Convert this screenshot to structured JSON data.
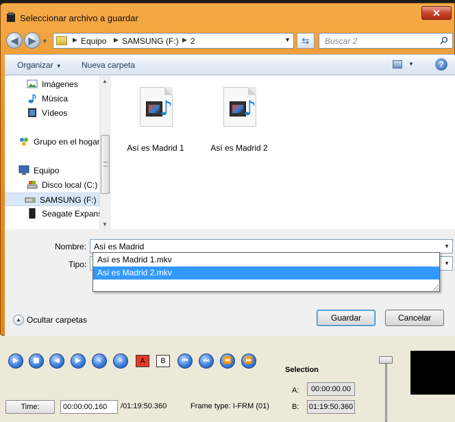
{
  "dialog": {
    "title": "Seleccionar archivo a guardar",
    "close_label": "✕",
    "breadcrumbs": [
      "Equipo",
      "SAMSUNG (F:)",
      "2"
    ],
    "search_placeholder": "Buscar 2",
    "toolbar": {
      "organize_label": "Organizar",
      "new_folder_label": "Nueva carpeta",
      "help_label": "?"
    },
    "nav_items": [
      {
        "label": "Imágenes",
        "icon": "pictures-icon"
      },
      {
        "label": "Música",
        "icon": "music-icon"
      },
      {
        "label": "Vídeos",
        "icon": "videos-icon"
      },
      {
        "label": "Grupo en el hogar",
        "icon": "homegroup-icon"
      },
      {
        "label": "Equipo",
        "icon": "computer-icon"
      },
      {
        "label": "Disco local (C:)",
        "icon": "local-disk-icon"
      },
      {
        "label": "SAMSUNG (F:)",
        "icon": "drive-icon",
        "selected": true
      },
      {
        "label": "Seagate Expansion",
        "icon": "external-drive-icon"
      }
    ],
    "files": [
      {
        "label": "Así es Madrid 1",
        "icon": "video-file-icon"
      },
      {
        "label": "Así es Madrid 2",
        "icon": "video-file-icon"
      }
    ],
    "form": {
      "name_label": "Nombre:",
      "name_value": "Así es Madrid",
      "type_label": "Tipo:",
      "suggestions": [
        "Así es Madrid 1.mkv",
        "Así es Madrid 2.mkv"
      ],
      "selected_suggestion": 1,
      "hide_folders_label": "Ocultar carpetas",
      "save_label": "Guardar",
      "cancel_label": "Cancelar"
    }
  },
  "player": {
    "time_button_label": "Time:",
    "current_time": "00:00:00.160",
    "total_time": "/01:19:50.360",
    "frame_type": "Frame type:  I-FRM (01)",
    "selection_title": "Selection",
    "sel_a_label": "A:",
    "sel_a_value": "00:00:00.00",
    "sel_b_label": "B:",
    "sel_b_value": "01:19:50.360",
    "marker_a_label": "A",
    "marker_b_label": "B"
  },
  "colors": {
    "titlebar": "#e98e22",
    "selection": "#3399ff",
    "control_blue": "#3b7fd9"
  }
}
